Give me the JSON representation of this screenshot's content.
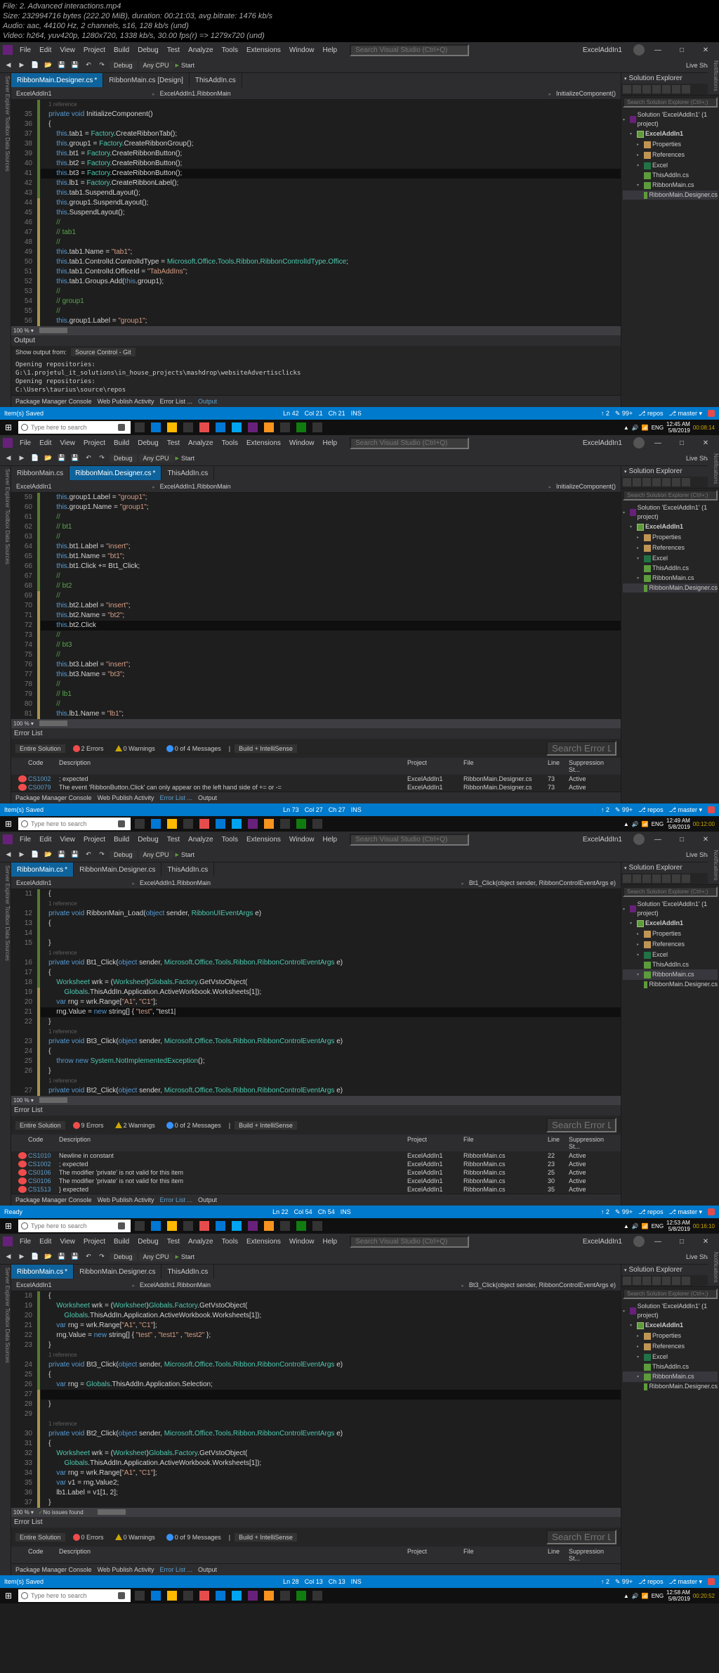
{
  "meta": {
    "file": "File: 2. Advanced interactions.mp4",
    "size": "Size: 232994716 bytes (222.20 MiB), duration: 00:21:03, avg.bitrate: 1476 kb/s",
    "audio": "Audio: aac, 44100 Hz, 2 channels, s16, 128 kb/s (und)",
    "video": "Video: h264, yuv420p, 1280x720, 1338 kb/s, 30.00 fps(r) => 1279x720 (und)"
  },
  "menu": [
    "File",
    "Edit",
    "View",
    "Project",
    "Build",
    "Debug",
    "Test",
    "Analyze",
    "Tools",
    "Extensions",
    "Window",
    "Help"
  ],
  "searchPlaceholder": "Search Visual Studio (Ctrl+Q)",
  "solutionName": "ExcelAddIn1",
  "toolbar": {
    "config": "Debug",
    "platform": "Any CPU",
    "start": "Start"
  },
  "liveShare": "Live Share",
  "tabs": {
    "s1": [
      "RibbonMain.Designer.cs",
      "RibbonMain.cs [Design]",
      "ThisAddIn.cs"
    ],
    "s2": [
      "RibbonMain.cs",
      "RibbonMain.Designer.cs",
      "ThisAddIn.cs"
    ],
    "s3": [
      "RibbonMain.cs",
      "RibbonMain.Designer.cs",
      "ThisAddIn.cs"
    ],
    "s4": [
      "RibbonMain.cs",
      "RibbonMain.Designer.cs",
      "ThisAddIn.cs"
    ]
  },
  "breadcrumb": {
    "project": "ExcelAddIn1",
    "class": "ExcelAddIn1.RibbonMain",
    "method_s1": "InitializeComponent()",
    "method_s3": "Bt1_Click(object sender, RibbonControlEventArgs e)",
    "method_s4": "Bt3_Click(object sender, RibbonControlEventArgs e)"
  },
  "solExp": {
    "title": "Solution Explorer",
    "search": "Search Solution Explorer (Ctrl+;)",
    "sln": "Solution 'ExcelAddIn1' (1 project)",
    "proj": "ExcelAddIn1",
    "props": "Properties",
    "refs": "References",
    "excel": "Excel",
    "this": "ThisAddIn.cs",
    "ribbon": "RibbonMain.cs",
    "designer": "RibbonMain.Designer.cs"
  },
  "output": {
    "title": "Output",
    "from": "Show output from:",
    "fromVal": "Source Control - Git",
    "lines": [
      "Opening repositories:",
      "G:\\1.projetul_it_solutions\\in_house_projects\\mashdrop\\websiteAdvertisclicks",
      "Opening repositories:",
      "C:\\Users\\taurius\\source\\repos"
    ]
  },
  "errList": {
    "title": "Error List",
    "scope": "Entire Solution",
    "build": "Build + IntelliSense",
    "search": "Search Error List",
    "cols": [
      "",
      "Code",
      "Description",
      "Project",
      "File",
      "Line",
      "Suppression St..."
    ],
    "s1_counts": {
      "err": "2 Errors",
      "warn": "0 Warnings",
      "info": "0 of 4 Messages"
    },
    "s1": [
      {
        "type": "e",
        "code": "CS1002",
        "desc": "; expected",
        "proj": "ExcelAddIn1",
        "file": "RibbonMain.Designer.cs",
        "line": "73",
        "sup": "Active"
      },
      {
        "type": "e",
        "code": "CS0079",
        "desc": "The event 'RibbonButton.Click' can only appear on the left hand side of += or -=",
        "proj": "ExcelAddIn1",
        "file": "RibbonMain.Designer.cs",
        "line": "73",
        "sup": "Active"
      }
    ],
    "s3_counts": {
      "err": "9 Errors",
      "warn": "2 Warnings",
      "info": "0 of 2 Messages"
    },
    "s3": [
      {
        "type": "e",
        "code": "CS1010",
        "desc": "Newline in constant",
        "proj": "ExcelAddIn1",
        "file": "RibbonMain.cs",
        "line": "22",
        "sup": "Active"
      },
      {
        "type": "e",
        "code": "CS1002",
        "desc": "; expected",
        "proj": "ExcelAddIn1",
        "file": "RibbonMain.cs",
        "line": "23",
        "sup": "Active"
      },
      {
        "type": "e",
        "code": "CS0106",
        "desc": "The modifier 'private' is not valid for this item",
        "proj": "ExcelAddIn1",
        "file": "RibbonMain.cs",
        "line": "25",
        "sup": "Active"
      },
      {
        "type": "e",
        "code": "CS0106",
        "desc": "The modifier 'private' is not valid for this item",
        "proj": "ExcelAddIn1",
        "file": "RibbonMain.cs",
        "line": "30",
        "sup": "Active"
      },
      {
        "type": "e",
        "code": "CS1513",
        "desc": "} expected",
        "proj": "ExcelAddIn1",
        "file": "RibbonMain.cs",
        "line": "35",
        "sup": "Active"
      }
    ],
    "s4_counts": {
      "err": "0 Errors",
      "warn": "0 Warnings",
      "info": "0 of 9 Messages"
    },
    "s4_issues": "No issues found"
  },
  "footerLinks": [
    "Package Manager Console",
    "Web Publish Activity",
    "Error List ...",
    "Output"
  ],
  "status": {
    "s1": {
      "left": "Item(s) Saved",
      "ln": "Ln 42",
      "col": "Col 21",
      "ch": "Ch 21",
      "ins": "INS",
      "changes": "2",
      "pending": "99+",
      "repo": "repos",
      "branch": "master"
    },
    "s2": {
      "left": "Item(s) Saved",
      "ln": "Ln 73",
      "col": "Col 27",
      "ch": "Ch 27",
      "ins": "INS"
    },
    "s3": {
      "left": "Ready",
      "ln": "Ln 22",
      "col": "Col 54",
      "ch": "Ch 54",
      "ins": "INS"
    },
    "s4": {
      "left": "Item(s) Saved",
      "ln": "Ln 28",
      "col": "Col 13",
      "ch": "Ch 13",
      "ins": "INS"
    }
  },
  "taskbar": {
    "search": "Type here to search",
    "time1": "12:45 AM",
    "date1": "5/8/2019",
    "ts1": "00:08:14",
    "time2": "12:49 AM",
    "date2": "5/8/2019",
    "ts2": "00:12:00",
    "time3": "12:53 AM",
    "date3": "5/8/2019",
    "ts3": "00:16:10",
    "time4": "12:58 AM",
    "date4": "5/8/2019",
    "ts4": "00:20:52",
    "eng": "ENG"
  },
  "code_s1_start": 35,
  "code_s1": [
    "1 reference",
    "private void InitializeComponent()",
    "{",
    "    this.tab1 = Factory.CreateRibbonTab();",
    "    this.group1 = Factory.CreateRibbonGroup();",
    "    this.bt1 = Factory.CreateRibbonButton();",
    "    this.bt2 = Factory.CreateRibbonButton();",
    "    this.bt3 = Factory.CreateRibbonButton();",
    "    this.lb1 = Factory.CreateRibbonLabel();",
    "    this.tab1.SuspendLayout();",
    "    this.group1.SuspendLayout();",
    "    this.SuspendLayout();",
    "    //",
    "    // tab1",
    "    //",
    "    this.tab1.Name = \"tab1\";",
    "    this.tab1.ControlId.ControlIdType = Microsoft.Office.Tools.Ribbon.RibbonControlIdType.Office;",
    "    this.tab1.ControlId.OfficeId = \"TabAddIns\";",
    "    this.tab1.Groups.Add(this.group1);",
    "    //",
    "    // group1",
    "    //",
    "    this.group1.Label = \"group1\";"
  ],
  "code_s2_start": 59,
  "code_s2": [
    "    this.group1.Label = \"group1\";",
    "    this.group1.Name = \"group1\";",
    "    //",
    "    // bt1",
    "    //",
    "    this.bt1.Label = \"insert\";",
    "    this.bt1.Name = \"bt1\";",
    "    this.bt1.Click += Bt1_Click;",
    "    //",
    "    // bt2",
    "    //",
    "    this.bt2.Label = \"insert\";",
    "    this.bt2.Name = \"bt2\";",
    "    this.bt2.Click",
    "    //",
    "    // bt3",
    "    //",
    "    this.bt3.Label = \"insert\";",
    "    this.bt3.Name = \"bt3\";",
    "    //",
    "    // lb1",
    "    //",
    "    this.lb1.Name = \"lb1\";"
  ],
  "code_s3_start": 11,
  "code_s3": [
    "{",
    "1 reference",
    "private void RibbonMain_Load(object sender, RibbonUIEventArgs e)",
    "{",
    "",
    "}",
    "1 reference",
    "private void Bt1_Click(object sender, Microsoft.Office.Tools.Ribbon.RibbonControlEventArgs e)",
    "{",
    "    Worksheet wrk = (Worksheet)Globals.Factory.GetVstoObject(",
    "        Globals.ThisAddIn.Application.ActiveWorkbook.Worksheets[1]);",
    "    var rng = wrk.Range[\"A1\", \"C1\"];",
    "    rng.Value = new string[] { \"test\", \"test1|",
    "}",
    "1 reference",
    "private void Bt3_Click(object sender, Microsoft.Office.Tools.Ribbon.RibbonControlEventArgs e)",
    "{",
    "    throw new System.NotImplementedException();",
    "}",
    "1 reference",
    "private void Bt2_Click(object sender, Microsoft.Office.Tools.Ribbon.RibbonControlEventArgs e)"
  ],
  "code_s4_start": 18,
  "code_s4": [
    "{",
    "    Worksheet wrk = (Worksheet)Globals.Factory.GetVstoObject(",
    "        Globals.ThisAddIn.Application.ActiveWorkbook.Worksheets[1]);",
    "    var rng = wrk.Range[\"A1\", \"C1\"];",
    "    rng.Value = new string[] { \"test\" , \"test1\" , \"test2\" };",
    "}",
    "1 reference",
    "private void Bt3_Click(object sender, Microsoft.Office.Tools.Ribbon.RibbonControlEventArgs e)",
    "{",
    "    var rng = Globals.ThisAddIn.Application.Selection;",
    "    ",
    "}",
    "",
    "1 reference",
    "private void Bt2_Click(object sender, Microsoft.Office.Tools.Ribbon.RibbonControlEventArgs e)",
    "{",
    "    Worksheet wrk = (Worksheet)Globals.Factory.GetVstoObject(",
    "        Globals.ThisAddIn.Application.ActiveWorkbook.Worksheets[1]);",
    "    var rng = wrk.Range[\"A1\", \"C1\"];",
    "    var v1 = rng.Value2;",
    "    lb1.Label = v1[1, 2];",
    "}"
  ]
}
